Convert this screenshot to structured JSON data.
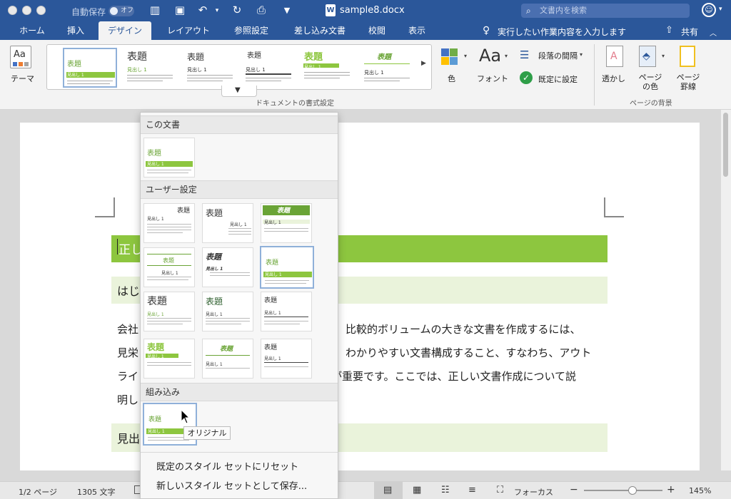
{
  "titlebar": {
    "autosave_label": "自動保存",
    "autosave_state": "オフ",
    "doc_title": "sample8.docx",
    "search_placeholder": "文書内を検索"
  },
  "tabs": [
    "ホーム",
    "挿入",
    "デザイン",
    "レイアウト",
    "参照設定",
    "差し込み文書",
    "校閲",
    "表示"
  ],
  "active_tab": "デザイン",
  "tell_me": "実行したい作業内容を入力します",
  "share": "共有",
  "ribbon": {
    "theme_label": "テーマ",
    "gallery_items": [
      {
        "title": "表題",
        "heading": "見出し 1"
      },
      {
        "title": "表題",
        "heading": "見出し 1"
      },
      {
        "title": "表題",
        "heading": "見出し 1"
      },
      {
        "title": "表題",
        "heading": "見出し 1"
      },
      {
        "title": "表題",
        "heading": "見出し 1"
      },
      {
        "title": "表題",
        "heading": "見出し 1"
      }
    ],
    "gallery_group_label": "ドキュメントの書式設定",
    "color_label": "色",
    "font_label": "フォント",
    "paragraph_spacing_label": "段落の間隔",
    "set_default_label": "既定に設定",
    "watermark_label": "透かし",
    "page_color_label": "ページの色",
    "page_border_label": "ページ罫線",
    "page_bg_group_label": "ページの背景"
  },
  "document": {
    "heading1_fragment": "正し",
    "heading2_fragment": "はじ",
    "body_left": [
      "会社",
      "見栄",
      "ライ",
      "明し"
    ],
    "body_right": [
      "比較的ボリュームの大きな文書を作成するには、",
      "わかりやすい文書構成すること、すなわち、アウト",
      "が重要です。ここでは、正しい文書作成について説",
      ""
    ],
    "heading3_fragment": "見出"
  },
  "dropdown": {
    "section_this_doc": "この文書",
    "section_user": "ユーザー設定",
    "section_builtin": "組み込み",
    "thumb_title": "表題",
    "thumb_heading": "見出し 1",
    "reset_label": "既定のスタイル セットにリセット",
    "save_label": "新しいスタイル セットとして保存...",
    "tooltip": "オリジナル"
  },
  "status": {
    "page": "1/2 ページ",
    "words": "1305 文字",
    "focus": "フォーカス",
    "zoom": "145%",
    "zoom_level": 0.62
  },
  "colors": {
    "brand_blue": "#2b579a",
    "accent_green": "#8dc63f",
    "light_green": "#eaf3db"
  }
}
